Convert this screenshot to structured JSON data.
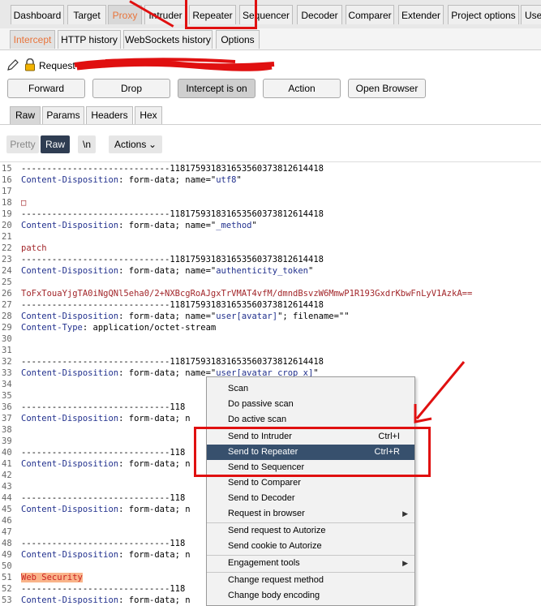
{
  "top_tabs": [
    "Dashboard",
    "Target",
    "Proxy",
    "Intruder",
    "Repeater",
    "Sequencer",
    "Decoder",
    "Comparer",
    "Extender",
    "Project options",
    "Use"
  ],
  "proxy_tabs": [
    "Intercept",
    "HTTP history",
    "WebSockets history",
    "Options"
  ],
  "request_label": "Request to",
  "buttons": {
    "forward": "Forward",
    "drop": "Drop",
    "intercept": "Intercept is on",
    "action": "Action",
    "open_browser": "Open Browser"
  },
  "view_tabs": [
    "Raw",
    "Params",
    "Headers",
    "Hex"
  ],
  "toolbar": {
    "pretty": "Pretty",
    "raw": "Raw",
    "newline": "\\n",
    "actions": "Actions"
  },
  "lines": [
    {
      "n": "15",
      "t": "dash",
      "text": "-----------------------------118175931831653560373812614418"
    },
    {
      "n": "16",
      "t": "cd",
      "key": "Content-Disposition",
      "rest": ": form-data; name=\"",
      "name": "utf8",
      "end": "\""
    },
    {
      "n": "17",
      "t": "blank"
    },
    {
      "n": "18",
      "t": "val",
      "text": "□"
    },
    {
      "n": "19",
      "t": "dash",
      "text": "-----------------------------118175931831653560373812614418"
    },
    {
      "n": "20",
      "t": "cd",
      "key": "Content-Disposition",
      "rest": ": form-data; name=\"",
      "name": "_method",
      "end": "\""
    },
    {
      "n": "21",
      "t": "blank"
    },
    {
      "n": "22",
      "t": "val",
      "text": "patch"
    },
    {
      "n": "23",
      "t": "dash",
      "text": "-----------------------------118175931831653560373812614418"
    },
    {
      "n": "24",
      "t": "cd",
      "key": "Content-Disposition",
      "rest": ": form-data; name=\"",
      "name": "authenticity_token",
      "end": "\""
    },
    {
      "n": "25",
      "t": "blank"
    },
    {
      "n": "26",
      "t": "val",
      "text": "ToFxTouaYjgTA0iNgQNl5eha0/2+NXBcgRoAJgxTrVMAT4vfM/dmndBsvzW6MmwP1R193GxdrKbwFnLyV1AzkA=="
    },
    {
      "n": "27",
      "t": "dash",
      "text": "-----------------------------118175931831653560373812614418"
    },
    {
      "n": "28",
      "t": "cd",
      "key": "Content-Disposition",
      "rest": ": form-data; name=\"",
      "name": "user[avatar]",
      "end": "\"; filename=\"\""
    },
    {
      "n": "29",
      "t": "ct",
      "key": "Content-Type",
      "rest": ": application/octet-stream"
    },
    {
      "n": "30",
      "t": "blank"
    },
    {
      "n": "31",
      "t": "blank"
    },
    {
      "n": "32",
      "t": "dash",
      "text": "-----------------------------118175931831653560373812614418"
    },
    {
      "n": "33",
      "t": "cd",
      "key": "Content-Disposition",
      "rest": ": form-data; name=\"",
      "name": "user[avatar_crop_x]",
      "end": "\""
    },
    {
      "n": "34",
      "t": "blank"
    },
    {
      "n": "35",
      "t": "blank"
    },
    {
      "n": "36",
      "t": "dash",
      "text": "-----------------------------118"
    },
    {
      "n": "37",
      "t": "cd",
      "key": "Content-Disposition",
      "rest": ": form-data; n",
      "name": "",
      "end": ""
    },
    {
      "n": "38",
      "t": "blank"
    },
    {
      "n": "39",
      "t": "blank"
    },
    {
      "n": "40",
      "t": "dash",
      "text": "-----------------------------118"
    },
    {
      "n": "41",
      "t": "cd",
      "key": "Content-Disposition",
      "rest": ": form-data; n",
      "name": "",
      "end": ""
    },
    {
      "n": "42",
      "t": "blank"
    },
    {
      "n": "43",
      "t": "blank"
    },
    {
      "n": "44",
      "t": "dash",
      "text": "-----------------------------118"
    },
    {
      "n": "45",
      "t": "cd",
      "key": "Content-Disposition",
      "rest": ": form-data; n",
      "name": "",
      "end": ""
    },
    {
      "n": "46",
      "t": "blank"
    },
    {
      "n": "47",
      "t": "blank"
    },
    {
      "n": "48",
      "t": "dash",
      "text": "-----------------------------118"
    },
    {
      "n": "49",
      "t": "cd",
      "key": "Content-Disposition",
      "rest": ": form-data; n",
      "name": "",
      "end": ""
    },
    {
      "n": "50",
      "t": "blank"
    },
    {
      "n": "51",
      "t": "hl",
      "text": "Web Security"
    },
    {
      "n": "52",
      "t": "dash",
      "text": "-----------------------------118"
    },
    {
      "n": "53",
      "t": "cd",
      "key": "Content-Disposition",
      "rest": ": form-data; n",
      "name": "",
      "end": ""
    }
  ],
  "menu": [
    {
      "label": "Scan"
    },
    {
      "label": "Do passive scan"
    },
    {
      "label": "Do active scan",
      "sep_after": true
    },
    {
      "label": "Send to Intruder",
      "shortcut": "Ctrl+I"
    },
    {
      "label": "Send to Repeater",
      "shortcut": "Ctrl+R",
      "selected": true
    },
    {
      "label": "Send to Sequencer"
    },
    {
      "label": "Send to Comparer"
    },
    {
      "label": "Send to Decoder"
    },
    {
      "label": "Request in browser",
      "submenu": true,
      "sep_after": true
    },
    {
      "label": "Send request to Autorize"
    },
    {
      "label": "Send cookie to Autorize",
      "sep_after": true
    },
    {
      "label": "Engagement tools",
      "submenu": true,
      "sep_after": true
    },
    {
      "label": "Change request method"
    },
    {
      "label": "Change body encoding"
    }
  ],
  "colors": {
    "accent": "#e8743b",
    "selection": "#37506d",
    "annotation": "#e01010"
  }
}
